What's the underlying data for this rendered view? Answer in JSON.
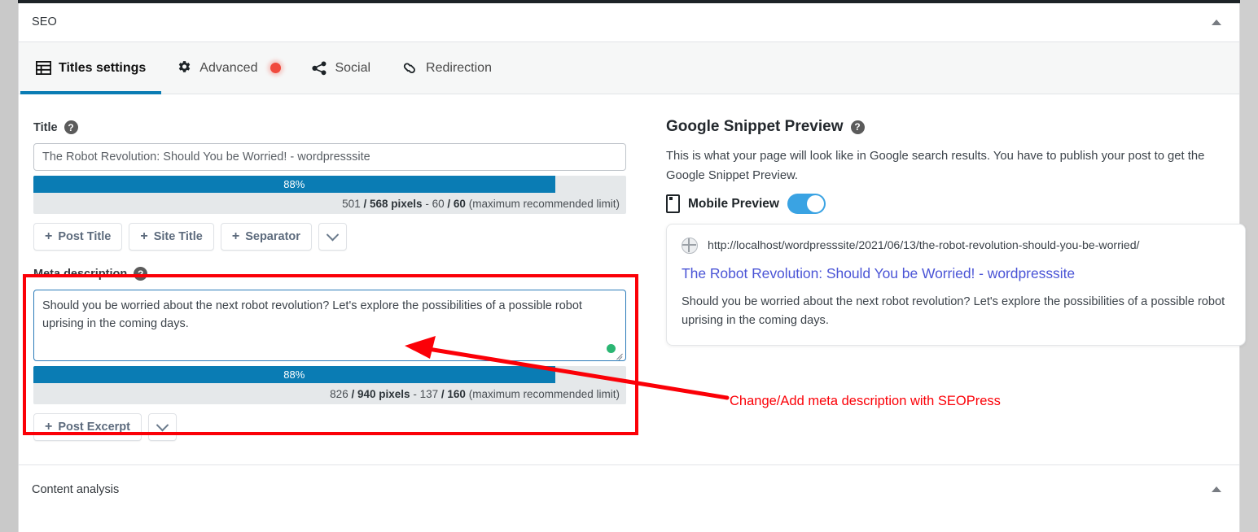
{
  "panel": {
    "title": "SEO",
    "collapse_icon": "triangle-up-icon"
  },
  "tabs": [
    {
      "label": "Titles settings",
      "icon": "table-grid-icon",
      "active": true,
      "badge": false
    },
    {
      "label": "Advanced",
      "icon": "gear-icon",
      "active": false,
      "badge": true
    },
    {
      "label": "Social",
      "icon": "share-nodes-icon",
      "active": false,
      "badge": false
    },
    {
      "label": "Redirection",
      "icon": "link-chain-icon",
      "active": false,
      "badge": false
    }
  ],
  "title_field": {
    "label": "Title",
    "help_icon": "question-mark-icon",
    "value": "The Robot Revolution: Should You be Worried! - wordpresssite",
    "placeholder": "",
    "meter": {
      "percent_label": "88%",
      "percent": 88,
      "pixels_used": "501",
      "pixels_sep": "/",
      "pixels_max": "568 pixels",
      "dash": "-",
      "chars_used": "60",
      "chars_sep": "/",
      "chars_max": "60",
      "limit_note": "(maximum recommended limit)"
    },
    "buttons": [
      {
        "label": "Post Title",
        "plus": "+"
      },
      {
        "label": "Site Title",
        "plus": "+"
      },
      {
        "label": "Separator",
        "plus": "+"
      }
    ],
    "more_icon": "chevron-down-icon"
  },
  "meta_field": {
    "label": "Meta description",
    "help_icon": "question-mark-icon",
    "value": "Should you be worried about the next robot revolution? Let's explore the possibilities of a possible robot uprising in the coming days.",
    "meter": {
      "percent_label": "88%",
      "percent": 88,
      "pixels_used": "826",
      "pixels_sep": "/",
      "pixels_max": "940 pixels",
      "dash": "-",
      "chars_used": "137",
      "chars_sep": "/",
      "chars_max": "160",
      "limit_note": "(maximum recommended limit)"
    },
    "buttons": [
      {
        "label": "Post Excerpt",
        "plus": "+"
      }
    ],
    "more_icon": "chevron-down-icon"
  },
  "snippet_preview": {
    "heading": "Google Snippet Preview",
    "help_icon": "question-mark-icon",
    "description": "This is what your page will look like in Google search results. You have to publish your post to get the Google Snippet Preview.",
    "mobile_toggle": {
      "label": "Mobile Preview",
      "icon": "mobile-phone-icon",
      "on": true
    },
    "card": {
      "url": "http://localhost/wordpresssite/2021/06/13/the-robot-revolution-should-you-be-worried/",
      "url_icon": "globe-icon",
      "title": "The Robot Revolution: Should You be Worried! - wordpresssite",
      "description": "Should you be worried about the next robot revolution? Let's explore the possibilities of a possible robot uprising in the coming days."
    }
  },
  "content_analysis": {
    "title": "Content analysis",
    "collapse_icon": "triangle-up-icon"
  },
  "annotation": {
    "text": "Change/Add meta description with SEOPress",
    "color": "#fb0007"
  },
  "colors": {
    "accent_blue": "#0a7cb4",
    "toggle_blue": "#3aa3e3",
    "meter_track": "#e5e8ea",
    "link_blue": "#4a54d6",
    "badge_red": "#f04a3e",
    "annotation_red": "#fb0007",
    "count_green": "#2bb673"
  }
}
